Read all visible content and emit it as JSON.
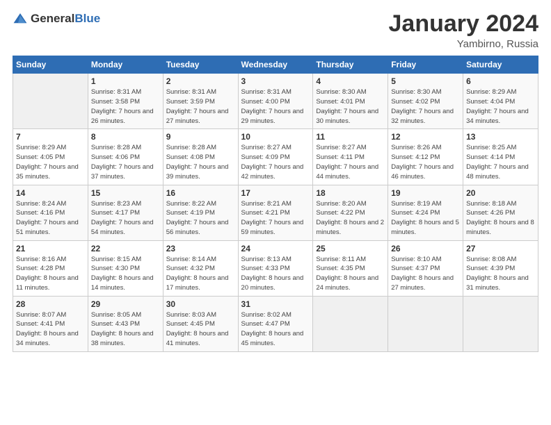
{
  "header": {
    "logo_general": "General",
    "logo_blue": "Blue",
    "title": "January 2024",
    "location": "Yambirno, Russia"
  },
  "weekdays": [
    "Sunday",
    "Monday",
    "Tuesday",
    "Wednesday",
    "Thursday",
    "Friday",
    "Saturday"
  ],
  "weeks": [
    [
      {
        "day": "",
        "sunrise": "",
        "sunset": "",
        "daylight": ""
      },
      {
        "day": "1",
        "sunrise": "Sunrise: 8:31 AM",
        "sunset": "Sunset: 3:58 PM",
        "daylight": "Daylight: 7 hours and 26 minutes."
      },
      {
        "day": "2",
        "sunrise": "Sunrise: 8:31 AM",
        "sunset": "Sunset: 3:59 PM",
        "daylight": "Daylight: 7 hours and 27 minutes."
      },
      {
        "day": "3",
        "sunrise": "Sunrise: 8:31 AM",
        "sunset": "Sunset: 4:00 PM",
        "daylight": "Daylight: 7 hours and 29 minutes."
      },
      {
        "day": "4",
        "sunrise": "Sunrise: 8:30 AM",
        "sunset": "Sunset: 4:01 PM",
        "daylight": "Daylight: 7 hours and 30 minutes."
      },
      {
        "day": "5",
        "sunrise": "Sunrise: 8:30 AM",
        "sunset": "Sunset: 4:02 PM",
        "daylight": "Daylight: 7 hours and 32 minutes."
      },
      {
        "day": "6",
        "sunrise": "Sunrise: 8:29 AM",
        "sunset": "Sunset: 4:04 PM",
        "daylight": "Daylight: 7 hours and 34 minutes."
      }
    ],
    [
      {
        "day": "7",
        "sunrise": "Sunrise: 8:29 AM",
        "sunset": "Sunset: 4:05 PM",
        "daylight": "Daylight: 7 hours and 35 minutes."
      },
      {
        "day": "8",
        "sunrise": "Sunrise: 8:28 AM",
        "sunset": "Sunset: 4:06 PM",
        "daylight": "Daylight: 7 hours and 37 minutes."
      },
      {
        "day": "9",
        "sunrise": "Sunrise: 8:28 AM",
        "sunset": "Sunset: 4:08 PM",
        "daylight": "Daylight: 7 hours and 39 minutes."
      },
      {
        "day": "10",
        "sunrise": "Sunrise: 8:27 AM",
        "sunset": "Sunset: 4:09 PM",
        "daylight": "Daylight: 7 hours and 42 minutes."
      },
      {
        "day": "11",
        "sunrise": "Sunrise: 8:27 AM",
        "sunset": "Sunset: 4:11 PM",
        "daylight": "Daylight: 7 hours and 44 minutes."
      },
      {
        "day": "12",
        "sunrise": "Sunrise: 8:26 AM",
        "sunset": "Sunset: 4:12 PM",
        "daylight": "Daylight: 7 hours and 46 minutes."
      },
      {
        "day": "13",
        "sunrise": "Sunrise: 8:25 AM",
        "sunset": "Sunset: 4:14 PM",
        "daylight": "Daylight: 7 hours and 48 minutes."
      }
    ],
    [
      {
        "day": "14",
        "sunrise": "Sunrise: 8:24 AM",
        "sunset": "Sunset: 4:16 PM",
        "daylight": "Daylight: 7 hours and 51 minutes."
      },
      {
        "day": "15",
        "sunrise": "Sunrise: 8:23 AM",
        "sunset": "Sunset: 4:17 PM",
        "daylight": "Daylight: 7 hours and 54 minutes."
      },
      {
        "day": "16",
        "sunrise": "Sunrise: 8:22 AM",
        "sunset": "Sunset: 4:19 PM",
        "daylight": "Daylight: 7 hours and 56 minutes."
      },
      {
        "day": "17",
        "sunrise": "Sunrise: 8:21 AM",
        "sunset": "Sunset: 4:21 PM",
        "daylight": "Daylight: 7 hours and 59 minutes."
      },
      {
        "day": "18",
        "sunrise": "Sunrise: 8:20 AM",
        "sunset": "Sunset: 4:22 PM",
        "daylight": "Daylight: 8 hours and 2 minutes."
      },
      {
        "day": "19",
        "sunrise": "Sunrise: 8:19 AM",
        "sunset": "Sunset: 4:24 PM",
        "daylight": "Daylight: 8 hours and 5 minutes."
      },
      {
        "day": "20",
        "sunrise": "Sunrise: 8:18 AM",
        "sunset": "Sunset: 4:26 PM",
        "daylight": "Daylight: 8 hours and 8 minutes."
      }
    ],
    [
      {
        "day": "21",
        "sunrise": "Sunrise: 8:16 AM",
        "sunset": "Sunset: 4:28 PM",
        "daylight": "Daylight: 8 hours and 11 minutes."
      },
      {
        "day": "22",
        "sunrise": "Sunrise: 8:15 AM",
        "sunset": "Sunset: 4:30 PM",
        "daylight": "Daylight: 8 hours and 14 minutes."
      },
      {
        "day": "23",
        "sunrise": "Sunrise: 8:14 AM",
        "sunset": "Sunset: 4:32 PM",
        "daylight": "Daylight: 8 hours and 17 minutes."
      },
      {
        "day": "24",
        "sunrise": "Sunrise: 8:13 AM",
        "sunset": "Sunset: 4:33 PM",
        "daylight": "Daylight: 8 hours and 20 minutes."
      },
      {
        "day": "25",
        "sunrise": "Sunrise: 8:11 AM",
        "sunset": "Sunset: 4:35 PM",
        "daylight": "Daylight: 8 hours and 24 minutes."
      },
      {
        "day": "26",
        "sunrise": "Sunrise: 8:10 AM",
        "sunset": "Sunset: 4:37 PM",
        "daylight": "Daylight: 8 hours and 27 minutes."
      },
      {
        "day": "27",
        "sunrise": "Sunrise: 8:08 AM",
        "sunset": "Sunset: 4:39 PM",
        "daylight": "Daylight: 8 hours and 31 minutes."
      }
    ],
    [
      {
        "day": "28",
        "sunrise": "Sunrise: 8:07 AM",
        "sunset": "Sunset: 4:41 PM",
        "daylight": "Daylight: 8 hours and 34 minutes."
      },
      {
        "day": "29",
        "sunrise": "Sunrise: 8:05 AM",
        "sunset": "Sunset: 4:43 PM",
        "daylight": "Daylight: 8 hours and 38 minutes."
      },
      {
        "day": "30",
        "sunrise": "Sunrise: 8:03 AM",
        "sunset": "Sunset: 4:45 PM",
        "daylight": "Daylight: 8 hours and 41 minutes."
      },
      {
        "day": "31",
        "sunrise": "Sunrise: 8:02 AM",
        "sunset": "Sunset: 4:47 PM",
        "daylight": "Daylight: 8 hours and 45 minutes."
      },
      {
        "day": "",
        "sunrise": "",
        "sunset": "",
        "daylight": ""
      },
      {
        "day": "",
        "sunrise": "",
        "sunset": "",
        "daylight": ""
      },
      {
        "day": "",
        "sunrise": "",
        "sunset": "",
        "daylight": ""
      }
    ]
  ]
}
